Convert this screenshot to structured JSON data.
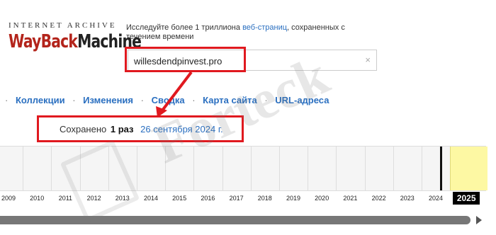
{
  "logo": {
    "top": "INTERNET ARCHIVE",
    "word1": "WayBack",
    "word2": "Machine"
  },
  "tagline": {
    "prefix": "Исследуйте более 1 триллиона ",
    "link": "веб-страниц",
    "suffix": ", сохраненных с течением времени"
  },
  "search": {
    "value": "willesdendpinvest.pro",
    "clear_icon": "×"
  },
  "nav": [
    {
      "label": "Коллекции"
    },
    {
      "label": "Изменения"
    },
    {
      "label": "Сводка"
    },
    {
      "label": "Карта сайта"
    },
    {
      "label": "URL-адреса"
    }
  ],
  "saved": {
    "prefix": "Сохранено",
    "count": "1 раз",
    "date": "26 сентября 2024 г."
  },
  "timeline": {
    "years": [
      "2009",
      "2010",
      "2011",
      "2012",
      "2013",
      "2014",
      "2015",
      "2016",
      "2017",
      "2018",
      "2019",
      "2020",
      "2021",
      "2022",
      "2023",
      "2024",
      "2025"
    ],
    "current_year": "2025",
    "highlight_color": "#fdf8a3"
  },
  "watermark": "Forteck",
  "colors": {
    "link": "#2a6fc0",
    "annotation": "#e0191f",
    "logo_red": "#b3241b"
  }
}
